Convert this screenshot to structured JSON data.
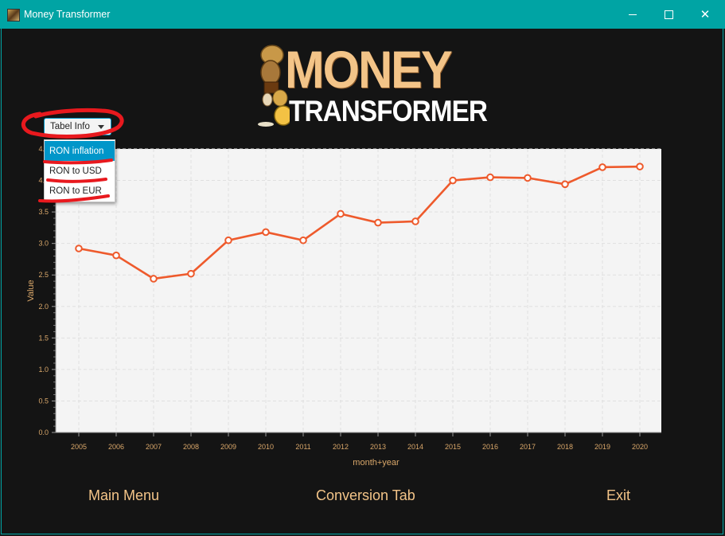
{
  "window": {
    "title": "Money Transformer",
    "icon": "money-app-icon",
    "controls": {
      "minimize": "minimize-icon",
      "maximize": "maximize-icon",
      "close": "close-icon"
    }
  },
  "logo": {
    "line1": "MONEY",
    "line2": "TRANSFORMER"
  },
  "dropdown": {
    "selected_label": "Tabel Info",
    "options": [
      "RON inflation",
      "RON to USD",
      "RON to EUR"
    ],
    "highlighted_index": 0
  },
  "buttons": {
    "main_menu": "Main Menu",
    "conversion_tab": "Conversion Tab",
    "exit": "Exit"
  },
  "colors": {
    "series_line": "#ee5a2c",
    "plot_background": "#f4f4f4",
    "accent": "#0096c9",
    "button_text": "#f3c488",
    "annotation": "#e8191e"
  },
  "chart_data": {
    "type": "line",
    "x": [
      "2005",
      "2006",
      "2007",
      "2008",
      "2009",
      "2010",
      "2011",
      "2012",
      "2013",
      "2014",
      "2015",
      "2016",
      "2017",
      "2018",
      "2019",
      "2020"
    ],
    "series": [
      {
        "values": [
          2.92,
          2.81,
          2.44,
          2.52,
          3.05,
          3.18,
          3.05,
          3.47,
          3.33,
          3.35,
          4.0,
          4.05,
          4.04,
          3.94,
          4.21,
          4.22
        ]
      }
    ],
    "xlabel": "month+year",
    "ylabel": "Value",
    "ylim": [
      0,
      4.5
    ],
    "yticks": [
      "0.0",
      "0.5",
      "1.0",
      "1.5",
      "2.0",
      "2.5",
      "3.0",
      "3.5",
      "4.0",
      "4.5"
    ],
    "grid": true
  }
}
